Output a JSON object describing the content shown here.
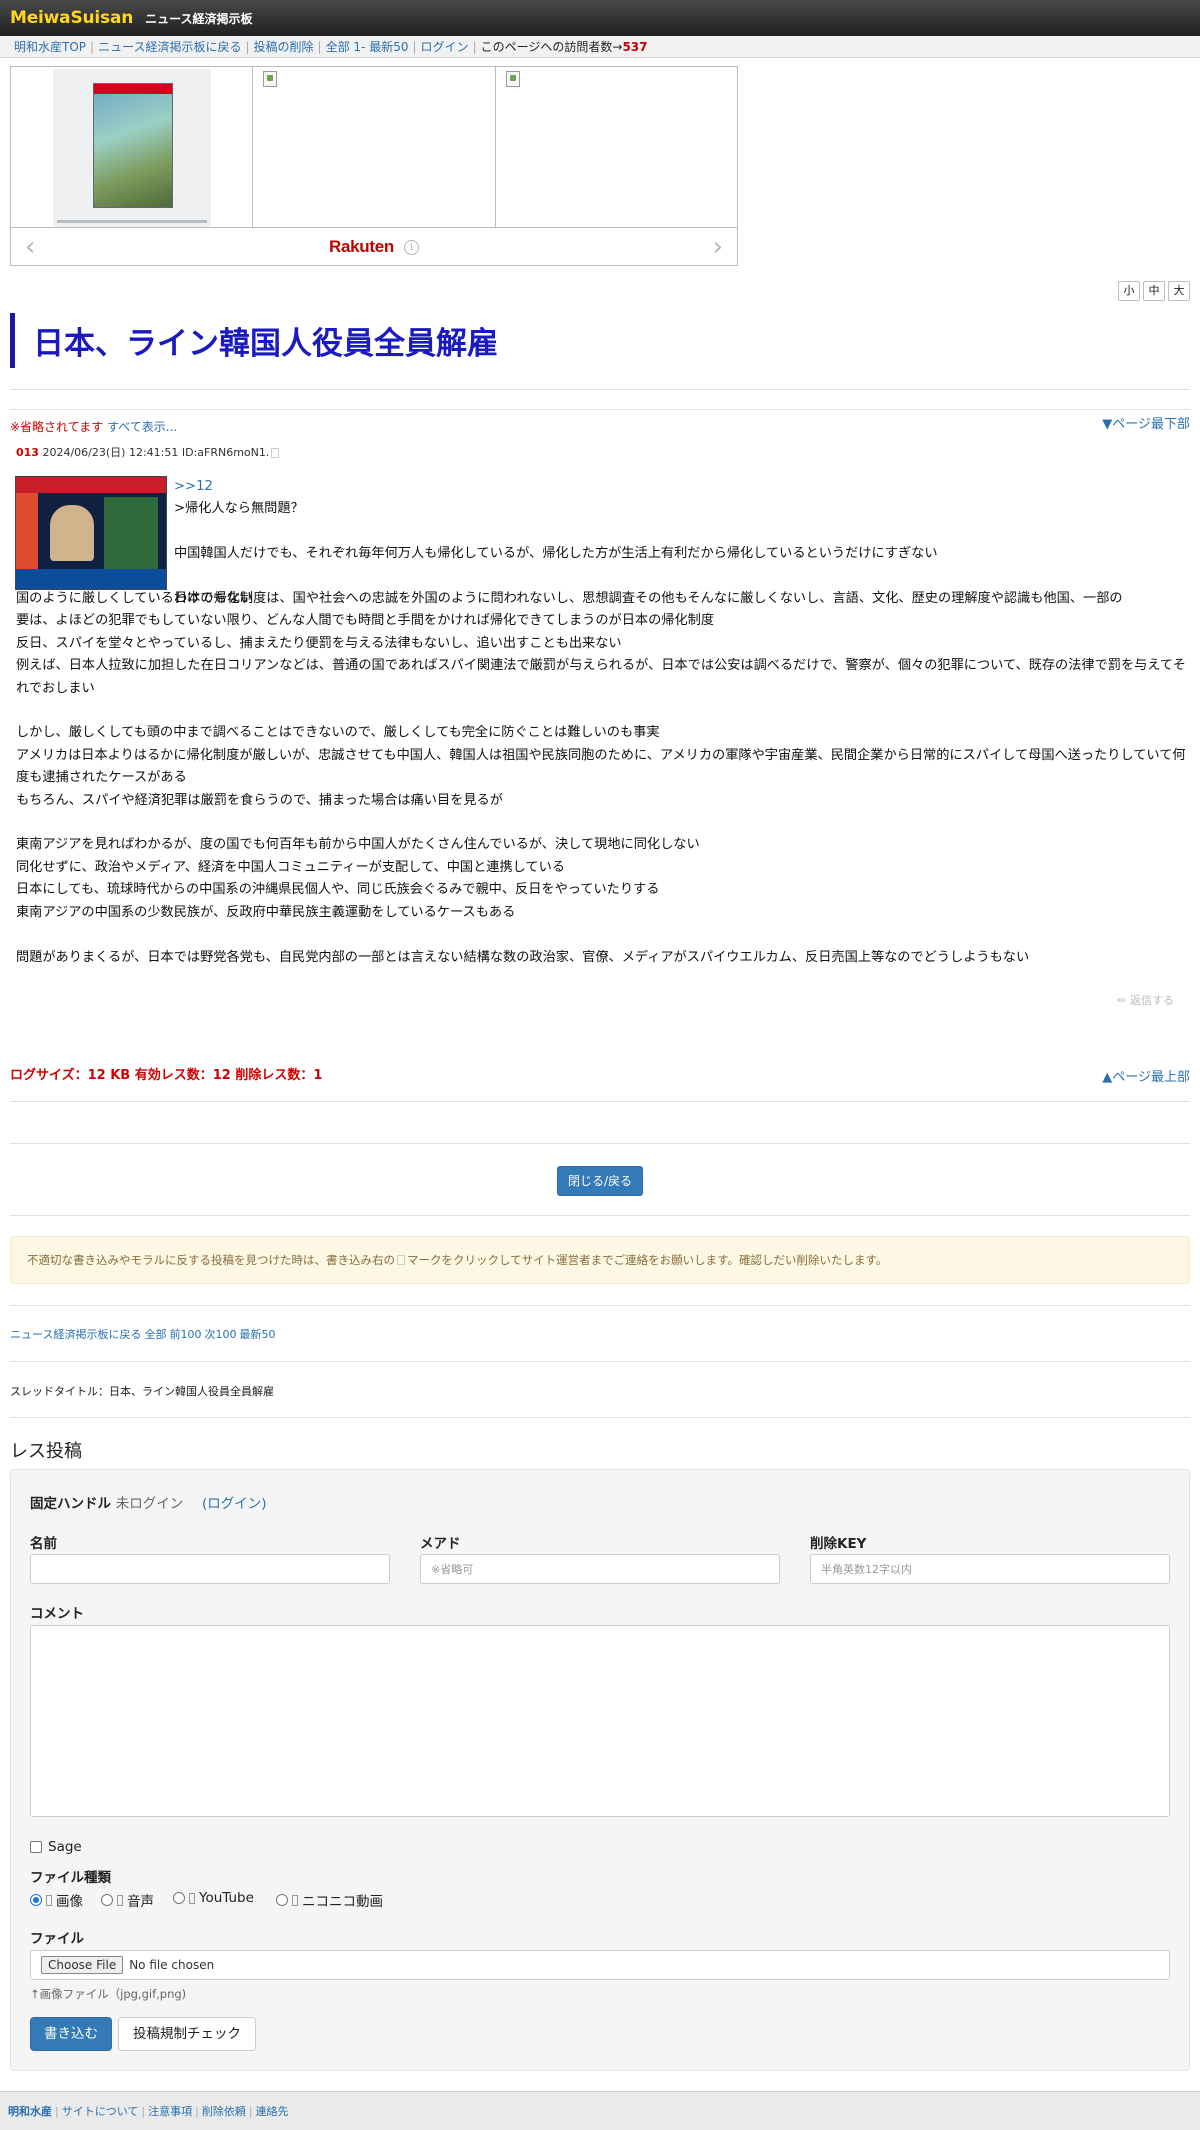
{
  "header": {
    "logo": "MeiwaSuisan",
    "title": "ニュース経済掲示板"
  },
  "nav": {
    "items": [
      "明和水産TOP",
      "ニュース経済掲示板に戻る",
      "投稿の削除",
      "全部",
      "1-",
      "最新50",
      "ログイン"
    ],
    "visitors_label": "このページへの訪問者数→",
    "visitors_count": "537"
  },
  "ad": {
    "brand": "Rakuten",
    "info": "i"
  },
  "font_sizes": {
    "small": "小",
    "medium": "中",
    "large": "大"
  },
  "thread": {
    "title": "日本、ライン韓国人役員全員解雇",
    "omitted_notice": "※省略されてます",
    "show_all": "すべて表示...",
    "to_bottom": "▼ページ最下部",
    "to_top": "▲ページ最上部"
  },
  "post": {
    "number": "013",
    "meta": "2024/06/23(日) 12:41:51 ID:aFRN6moN1.",
    "anchor": ">>12",
    "quote": ">帰化人なら無問題？",
    "lead_paragraph": "中国韓国人だけでも、それぞれ毎年何万人も帰化しているが、帰化した方が生活上有利だから帰化しているというだけにすぎない",
    "first_line": "日本の帰化制度は、国や社会への忠誠を外国のように問われないし、思想調査その他もそんなに厳しくないし、言語、文化、歴史の理解度や認識も他国、一部の",
    "body": "国のように厳しくしているわけでもない\n要は、よほどの犯罪でもしていない限り、どんな人間でも時間と手間をかければ帰化できてしまうのが日本の帰化制度\n反日、スパイを堂々とやっているし、捕まえたり便罰を与える法律もないし、追い出すことも出来ない\n例えば、日本人拉致に加担した在日コリアンなどは、普通の国であればスパイ関連法で厳罰が与えられるが、日本では公安は調べるだけで、警察が、個々の犯罪について、既存の法律で罰を与えてそれでおしまい\n\nしかし、厳しくしても頭の中まで調べることはできないので、厳しくしても完全に防ぐことは難しいのも事実\nアメリカは日本よりはるかに帰化制度が厳しいが、忠誠させても中国人、韓国人は祖国や民族同胞のために、アメリカの軍隊や宇宙産業、民間企業から日常的にスパイして母国へ送ったりしていて何度も逮捕されたケースがある\nもちろん、スパイや経済犯罪は厳罰を食らうので、捕まった場合は痛い目を見るが\n\n東南アジアを見ればわかるが、度の国でも何百年も前から中国人がたくさん住んでいるが、決して現地に同化しない\n同化せずに、政治やメディア、経済を中国人コミュニティーが支配して、中国と連携している\n日本にしても、琉球時代からの中国系の沖縄県民個人や、同じ氏族会ぐるみで親中、反日をやっていたりする\n東南アジアの中国系の少数民族が、反政府中華民族主義運動をしているケースもある\n\n問題がありまくるが、日本では野党各党も、自民党内部の一部とは言えない結構な数の政治家、官僚、メディアがスパイウエルカム、反日売国上等なのでどうしようもない",
    "reply": "✏ 返信する"
  },
  "log": {
    "summary": "ログサイズ：12 KB 有効レス数：12 削除レス数：1"
  },
  "close_button": "閉じる/戻る",
  "notice": {
    "before": "不適切な書き込みやモラルに反する投稿を見つけた時は、書き込み右の",
    "after": "マークをクリックしてサイト運営者までご連絡をお願いします。確認しだい削除いたします。"
  },
  "thread_links": [
    "ニュース経済掲示板に戻る",
    "全部",
    "前100",
    "次100",
    "最新50"
  ],
  "thread_name_line": "スレッドタイトル：日本、ライン韓国人役員全員解雇",
  "form": {
    "heading": "レス投稿",
    "handle_label": "固定ハンドル",
    "handle_status": "未ログイン",
    "login_link": "(ログイン)",
    "name_label": "名前",
    "mail_label": "メアド",
    "mail_placeholder": "※省略可",
    "delkey_label": "削除KEY",
    "delkey_placeholder": "半角英数12字以内",
    "comment_label": "コメント",
    "sage_label": "Sage",
    "filetype_label": "ファイル種類",
    "filetypes": [
      "画像",
      "音声",
      "YouTube",
      "ニコニコ動画"
    ],
    "file_label": "ファイル",
    "choose_file": "Choose File",
    "no_file": "No file chosen",
    "file_hint": "↑画像ファイル（jpg,gif,png)",
    "submit": "書き込む",
    "check": "投稿規制チェック"
  },
  "footer": {
    "brand": "明和水産",
    "links": [
      "サイトについて",
      "注意事項",
      "削除依頼",
      "連絡先"
    ]
  }
}
